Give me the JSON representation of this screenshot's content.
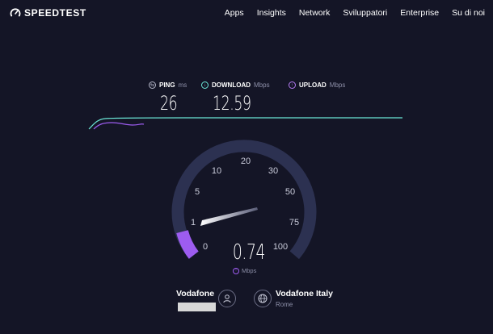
{
  "brand": {
    "name": "SPEEDTEST",
    "logo_icon": "speedometer-icon"
  },
  "nav": {
    "items": [
      "Apps",
      "Insights",
      "Network",
      "Sviluppatori",
      "Enterprise",
      "Su di noi"
    ]
  },
  "stats": {
    "ping": {
      "label": "PING",
      "unit": "ms",
      "value": "26",
      "icon": "ping-icon",
      "color": "#b5b7c9"
    },
    "download": {
      "label": "DOWNLOAD",
      "unit": "Mbps",
      "value": "12.59",
      "icon": "download-arrow-icon",
      "color": "#6be6d6"
    },
    "upload": {
      "label": "UPLOAD",
      "unit": "Mbps",
      "value": "",
      "icon": "upload-arrow-icon",
      "color": "#b57cf4"
    }
  },
  "gauge": {
    "ticks": [
      "0",
      "1",
      "5",
      "10",
      "20",
      "30",
      "50",
      "75",
      "100"
    ],
    "current_value": "0.74",
    "unit": "Mbps",
    "unit_icon": "upload-arrow-icon",
    "active_color": "#9d5cf0",
    "track_color": "#2c3151"
  },
  "isp": {
    "name": "Vodafone",
    "icon": "person-icon"
  },
  "server": {
    "name": "Vodafone Italy",
    "city": "Rome",
    "icon": "globe-icon"
  },
  "colors": {
    "background": "#141526",
    "download_line": "#6be6d6",
    "upload_line": "#9d5cf0"
  }
}
